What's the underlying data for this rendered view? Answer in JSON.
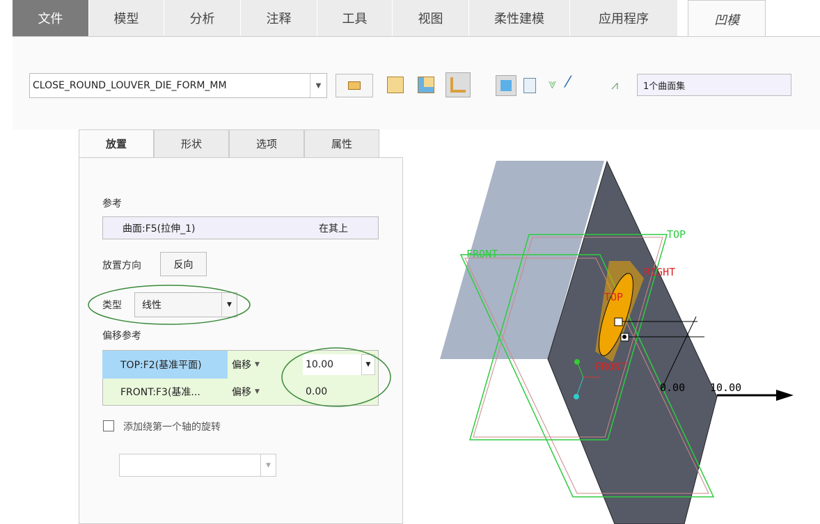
{
  "tabs": [
    {
      "label": "文件"
    },
    {
      "label": "模型"
    },
    {
      "label": "分析"
    },
    {
      "label": "注释"
    },
    {
      "label": "工具"
    },
    {
      "label": "视图"
    },
    {
      "label": "柔性建模"
    },
    {
      "label": "应用程序"
    },
    {
      "label": "凹模"
    }
  ],
  "toolbar": {
    "part_name": "CLOSE_ROUND_LOUVER_DIE_FORM_MM",
    "surface_set": "1个曲面集"
  },
  "subtabs": [
    {
      "label": "放置"
    },
    {
      "label": "形状"
    },
    {
      "label": "选项"
    },
    {
      "label": "属性"
    }
  ],
  "placement": {
    "reference_label": "参考",
    "reference_value": "曲面:F5(拉伸_1)",
    "reference_constraint": "在其上",
    "direction_label": "放置方向",
    "flip_button": "反向",
    "type_label": "类型",
    "type_value": "线性",
    "offset_ref_label": "偏移参考",
    "offset_rows": [
      {
        "ref": "TOP:F2(基准平面)",
        "mode": "偏移",
        "value": "10.00"
      },
      {
        "ref": "FRONT:F3(基准...",
        "mode": "偏移",
        "value": "0.00"
      }
    ],
    "rotation_checkbox": "添加绕第一个轴的旋转",
    "rotation_checked": false
  },
  "viewport": {
    "labels": {
      "front_green": "FRONT",
      "top_green": "TOP",
      "right_red": "RIGHT",
      "top_red": "TOP",
      "front_red": "FRONT"
    },
    "dims": {
      "d1": "0.00",
      "d2": "10.00"
    }
  },
  "colors": {
    "datum_green": "#2ecc40",
    "datum_red": "#d22",
    "part_light": "#a9b4c6",
    "part_dark": "#555a66",
    "highlight": "#f0a500"
  }
}
